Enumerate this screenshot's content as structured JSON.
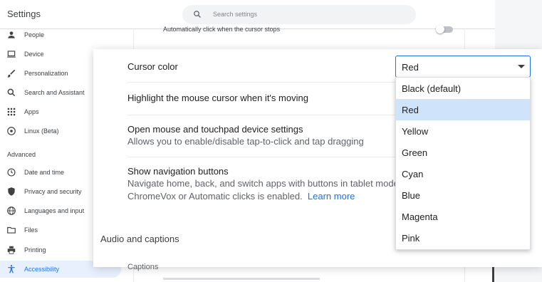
{
  "header": {
    "title": "Settings",
    "search_placeholder": "Search settings"
  },
  "sidebar": {
    "items": [
      {
        "label": "People",
        "icon": "person-icon"
      },
      {
        "label": "Device",
        "icon": "laptop-icon"
      },
      {
        "label": "Personalization",
        "icon": "brush-icon"
      },
      {
        "label": "Search and Assistant",
        "icon": "search-icon"
      },
      {
        "label": "Apps",
        "icon": "apps-grid-icon"
      },
      {
        "label": "Linux (Beta)",
        "icon": "linux-icon"
      }
    ],
    "advanced_label": "Advanced",
    "advanced_items": [
      {
        "label": "Date and time",
        "icon": "clock-icon"
      },
      {
        "label": "Privacy and security",
        "icon": "shield-icon"
      },
      {
        "label": "Languages and input",
        "icon": "globe-icon"
      },
      {
        "label": "Files",
        "icon": "folder-icon"
      },
      {
        "label": "Printing",
        "icon": "printer-icon"
      },
      {
        "label": "Accessibility",
        "icon": "accessibility-icon",
        "active": true
      }
    ]
  },
  "background_row": {
    "text": "Automatically click when the cursor stops",
    "toggle_on": false
  },
  "panel": {
    "cursor_color": {
      "label": "Cursor color",
      "value": "Red",
      "options": [
        "Black (default)",
        "Red",
        "Yellow",
        "Green",
        "Cyan",
        "Blue",
        "Magenta",
        "Pink"
      ],
      "selected_index": 1
    },
    "highlight_label": "Highlight the mouse cursor when it's moving",
    "device_settings": {
      "title": "Open mouse and touchpad device settings",
      "subtitle": "Allows you to enable/disable tap-to-click and tap dragging"
    },
    "nav_buttons": {
      "title": "Show navigation buttons",
      "line1": "Navigate home, back, and switch apps with buttons in tablet mode. Tu",
      "line2": "ChromeVox or Automatic clicks is enabled.",
      "learn_more": "Learn more"
    },
    "section_audio": "Audio and captions",
    "captions_label": "Captions"
  },
  "colors": {
    "accent": "#1a73e8",
    "selected_option_bg": "#cfe3fb",
    "active_nav_bg": "#e8f0fe"
  }
}
